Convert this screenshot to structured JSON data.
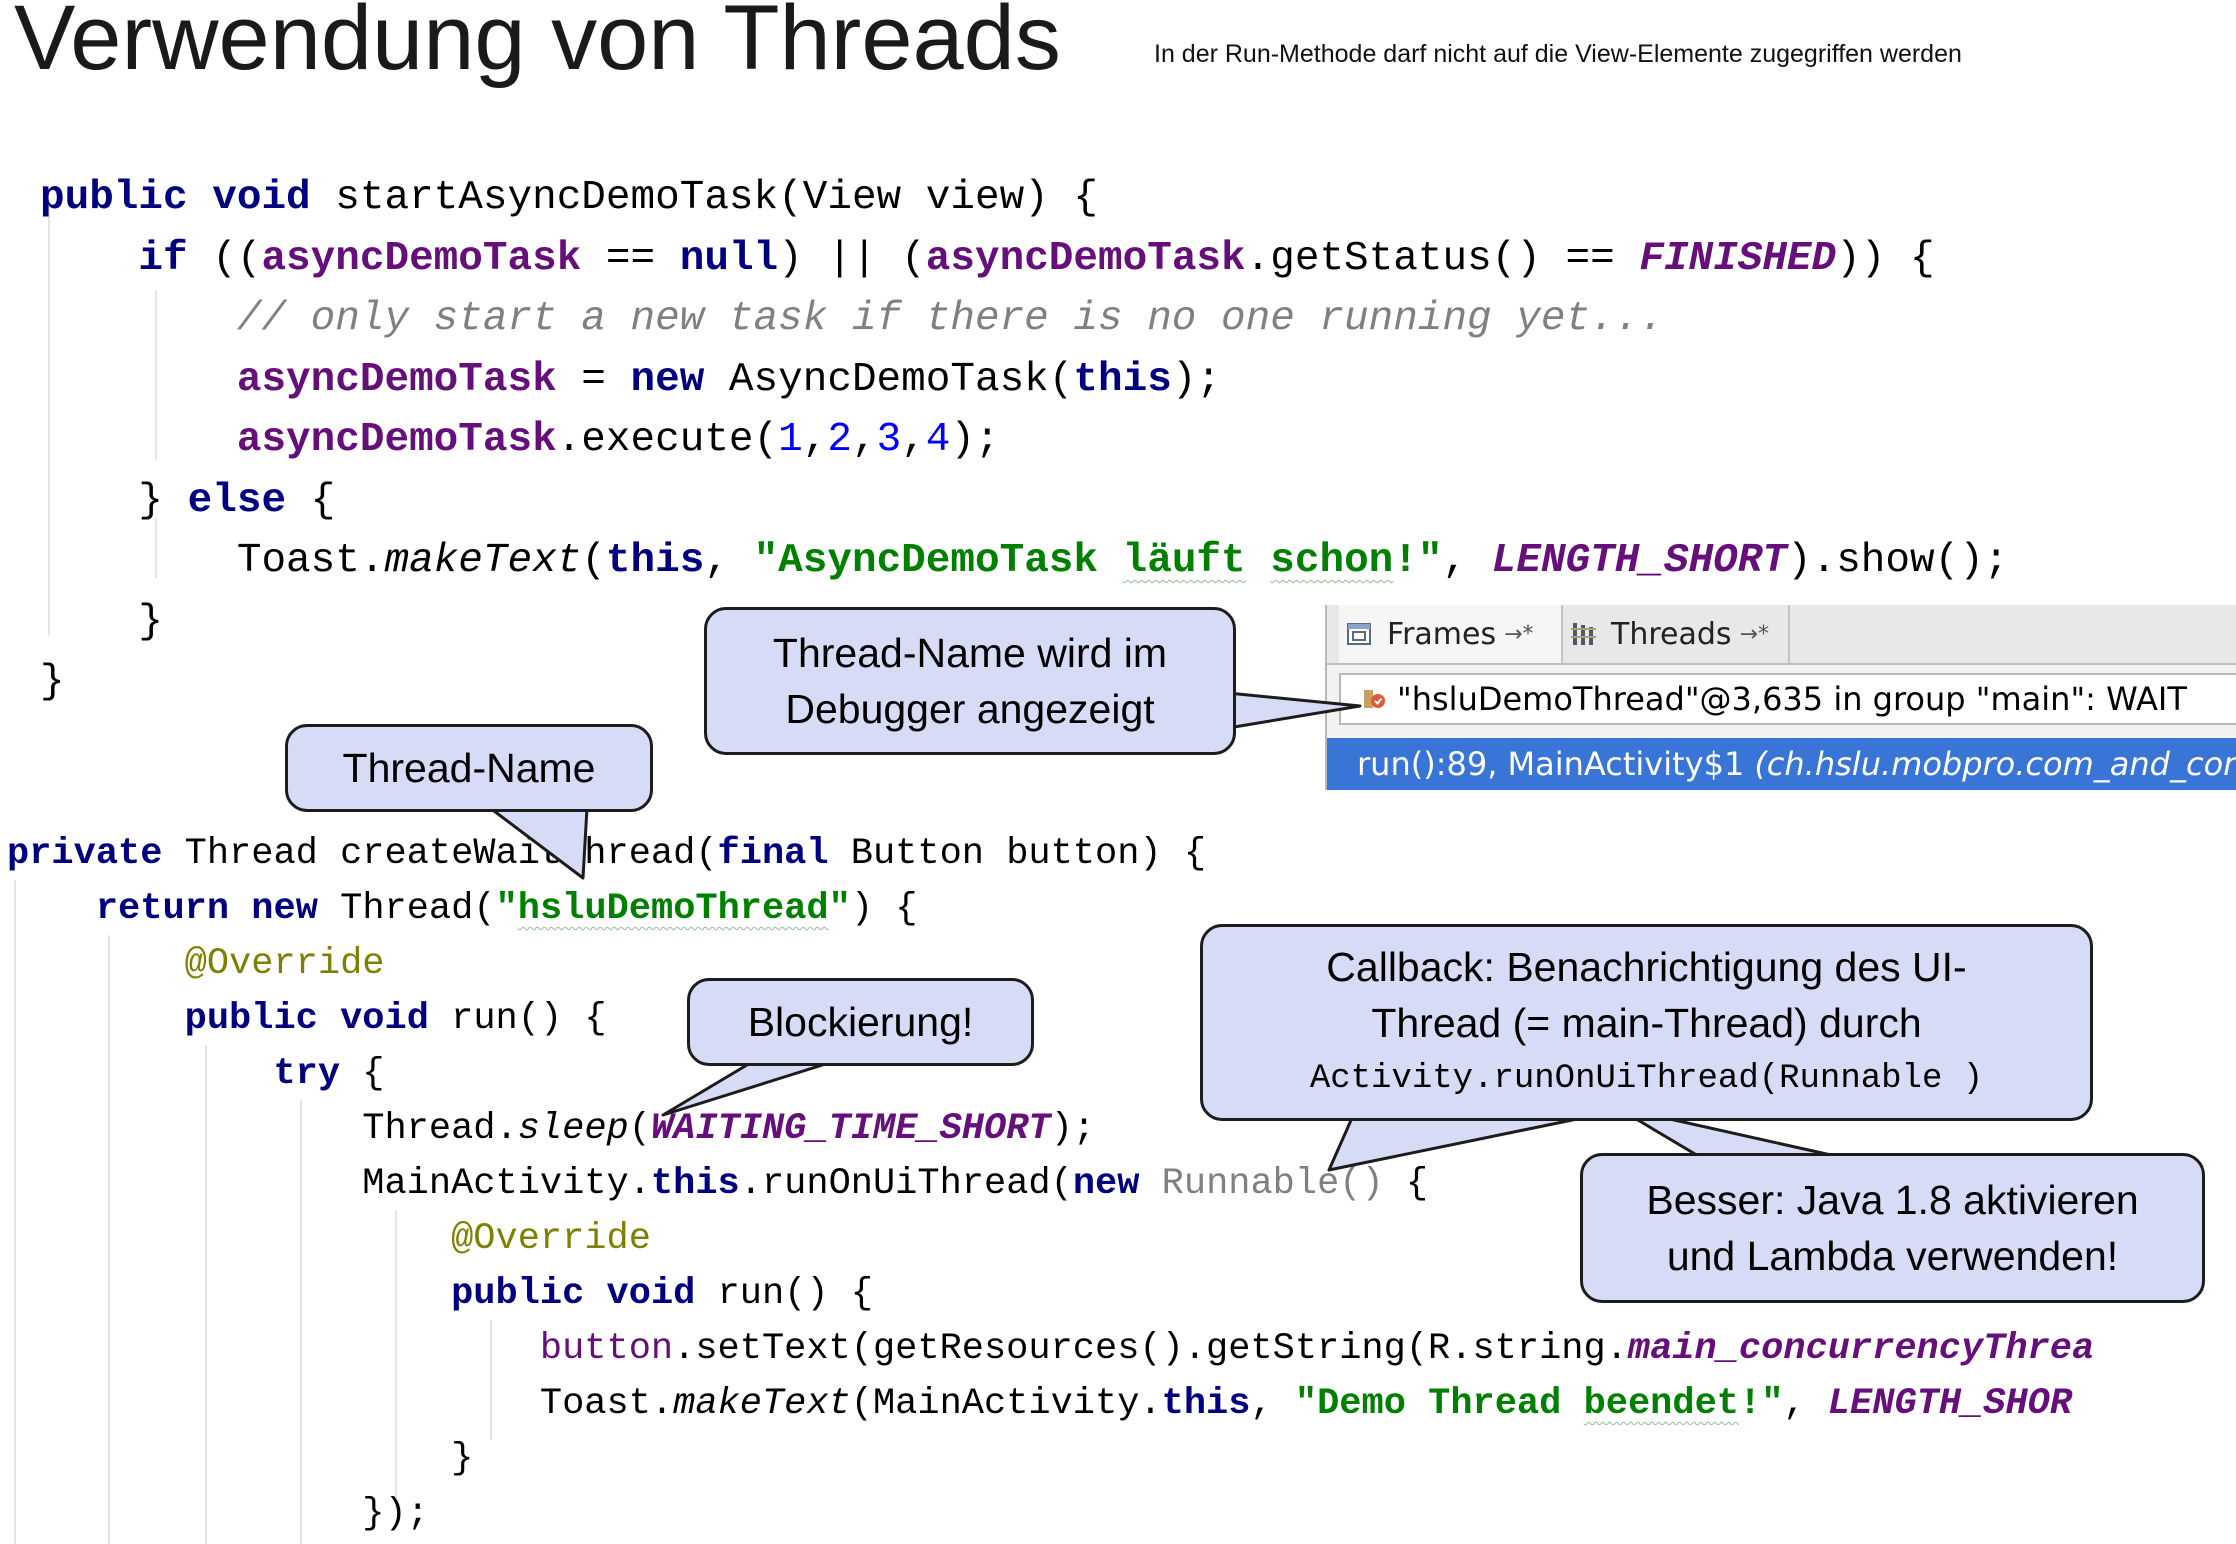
{
  "slide": {
    "title": "Verwendung von Threads",
    "subtitle": "In der Run-Methode darf nicht auf die View-Elemente zugegriffen werden"
  },
  "code_top": {
    "l1": [
      "public",
      "void",
      "startAsyncDemoTask(View view) {"
    ],
    "l2": [
      "if",
      " ((",
      "asyncDemoTask",
      " == ",
      "null",
      ") || (",
      "asyncDemoTask",
      ".getStatus() == ",
      "FINISHED",
      ")) {"
    ],
    "l3": "// only start a new task if there is no one running yet...",
    "l4": [
      "asyncDemoTask",
      " = ",
      "new",
      " AsyncDemoTask(",
      "this",
      ");"
    ],
    "l5": [
      "asyncDemoTask",
      ".execute(",
      "1",
      ",",
      "2",
      ",",
      "3",
      ",",
      "4",
      ");"
    ],
    "l6": [
      "} ",
      "else",
      " {"
    ],
    "l7": [
      "Toast.",
      "makeText",
      "(",
      "this",
      ", ",
      "\"AsyncDemoTask ",
      "läuft",
      " ",
      "schon",
      "!\"",
      ", ",
      "LENGTH_SHORT",
      ").show();"
    ],
    "l8": "}",
    "l9": "}"
  },
  "code_bottom": {
    "l1": [
      "private",
      " Thread createWaitThread(",
      "final",
      " Button button) {"
    ],
    "l2": [
      "return",
      " ",
      "new",
      " Thread(",
      "\"",
      "hsluDemoThread",
      "\"",
      ") {"
    ],
    "l3": "@Override",
    "l4": [
      "public",
      " ",
      "void",
      " run() {"
    ],
    "l5": [
      "try",
      " {"
    ],
    "l6": [
      "Thread.",
      "sleep",
      "(",
      "WAITING_TIME_SHORT",
      ");"
    ],
    "l7": [
      "MainActivity.",
      "this",
      ".runOnUiThread(",
      "new",
      " ",
      "Runnable()",
      " {"
    ],
    "l8": "@Override",
    "l9": [
      "public",
      " ",
      "void",
      " run() {"
    ],
    "l10": [
      "button",
      ".setText(getResources().getString(R.string.",
      "main_concurrencyThrea"
    ],
    "l11": [
      "Toast.",
      "makeText",
      "(MainActivity.",
      "this",
      ", ",
      "\"Demo ",
      "Thread",
      " ",
      "beendet",
      "!\"",
      ", ",
      "LENGTH_SHOR"
    ],
    "l12": "}",
    "l13": "});"
  },
  "callouts": {
    "debugger": [
      "Thread-Name wird im",
      "Debugger angezeigt"
    ],
    "thread_name": "Thread-Name",
    "blocking": "Blockierung!",
    "callback": [
      "Callback: Benachrichtigung des UI-",
      "Thread (= main-Thread) durch",
      "Activity.runOnUiThread(Runnable )"
    ],
    "java18": [
      "Besser: Java 1.8 aktivieren",
      "und Lambda verwenden!"
    ]
  },
  "debugger_panel": {
    "tab_frames": "Frames",
    "tab_threads": "Threads",
    "tab_pin": "→*",
    "thread_row": "\"hsluDemoThread\"@3,635 in group \"main\": WAIT",
    "frame_row": "run():89, MainActivity$1",
    "frame_pkg": "(ch.hslu.mobpro.com_and_con)"
  },
  "colors": {
    "keyword": "#000080",
    "field": "#660e7a",
    "string": "#008000",
    "number": "#0000ff",
    "comment": "#808080",
    "annotation": "#808000",
    "callout_fill": "#d7dcf6",
    "selection": "#3875d7"
  }
}
